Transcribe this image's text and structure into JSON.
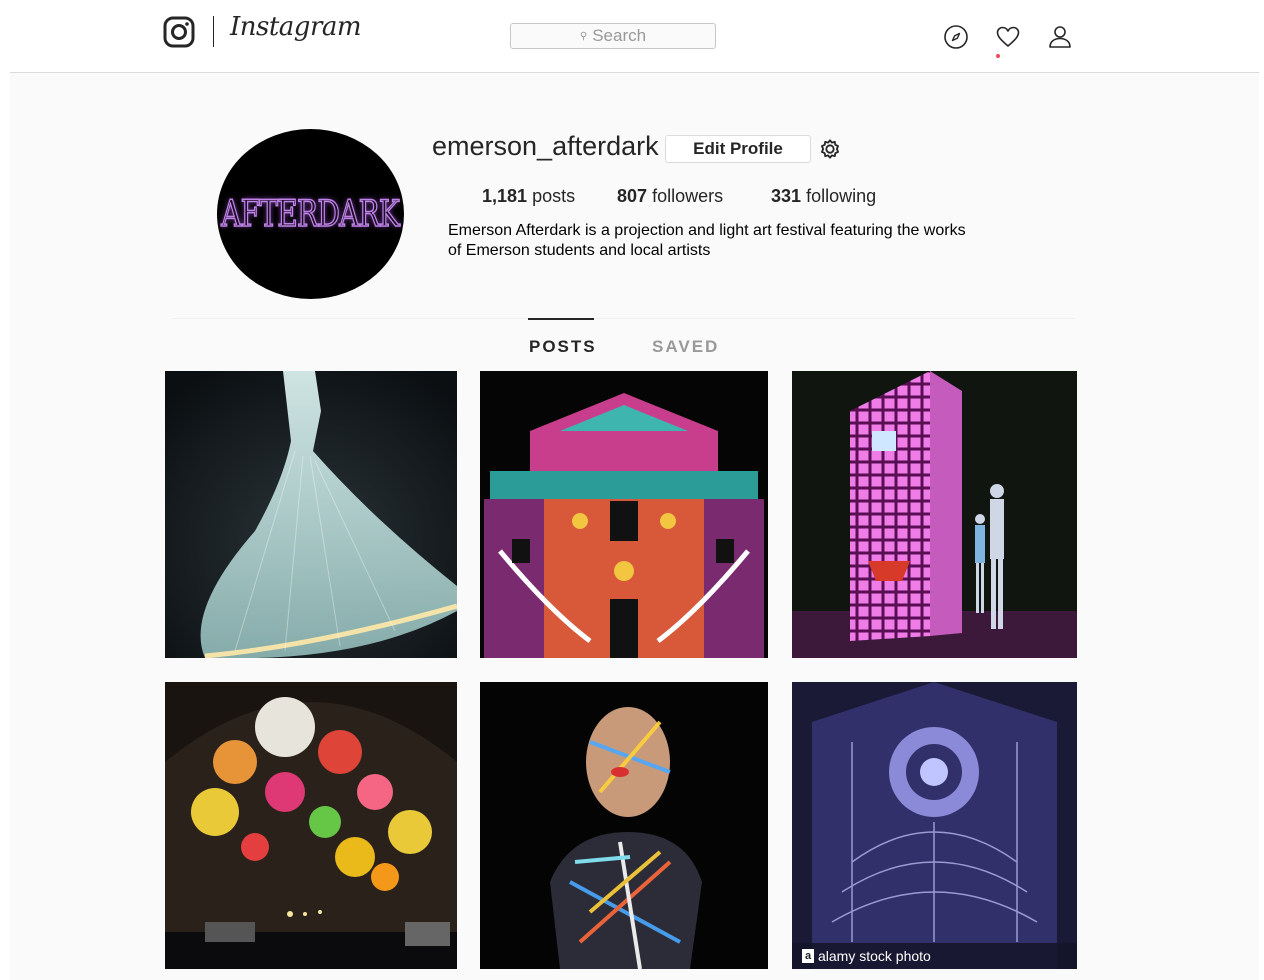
{
  "header": {
    "logo_text": "Instagram",
    "search": {
      "label": "Search",
      "icon": "search-icon"
    },
    "nav_icons": [
      "compass-icon",
      "heart-icon",
      "person-icon"
    ]
  },
  "profile": {
    "username": "emerson_afterdark",
    "edit_button_label": "Edit Profile",
    "avatar_text": "AFTERDARK",
    "stats": {
      "posts_count": "1,181",
      "posts_label": "posts",
      "followers_count": "807",
      "followers_label": "followers",
      "following_count": "331",
      "following_label": "following"
    },
    "bio_line1": "Emerson Afterdark is a projection and light art festival featuring the works",
    "bio_line2": "of Emerson students and local artists"
  },
  "tabs": {
    "posts": "POSTS",
    "saved": "SAVED",
    "active": "POSTS"
  },
  "grid": {
    "watermark_text": "alamy stock photo"
  },
  "colors": {
    "text": "#262626",
    "muted": "#999999",
    "notification_dot": "#ed4956",
    "background": "#fafafa"
  }
}
